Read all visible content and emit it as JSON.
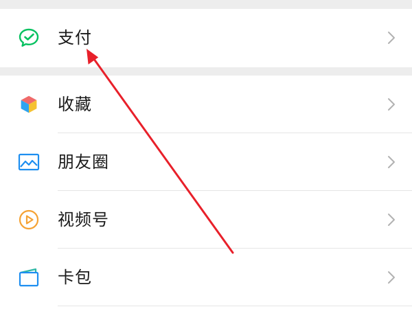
{
  "colors": {
    "page_background": "#ededed",
    "row_background": "#ffffff",
    "label_text": "#1a1a1a",
    "chevron": "#b2b2b2",
    "divider": "#e5e5e5",
    "pay_icon": "#07c160",
    "album_icon": "#1d8ef0",
    "channels_icon": "#f5a234",
    "cards_icon": "#1d8ef0",
    "annotation_arrow": "#e8202a"
  },
  "pay_section": {
    "label": "支付",
    "icon": "wechat-pay-icon"
  },
  "menu": {
    "favorites_label": "收藏",
    "favorites_icon": "cube-icon",
    "moments_label": "朋友圈",
    "moments_icon": "photo-album-icon",
    "channels_label": "视频号",
    "channels_icon": "play-circle-icon",
    "cards_label": "卡包",
    "cards_icon": "card-wallet-icon"
  },
  "annotation": {
    "type": "arrow",
    "points_to": "支付"
  }
}
